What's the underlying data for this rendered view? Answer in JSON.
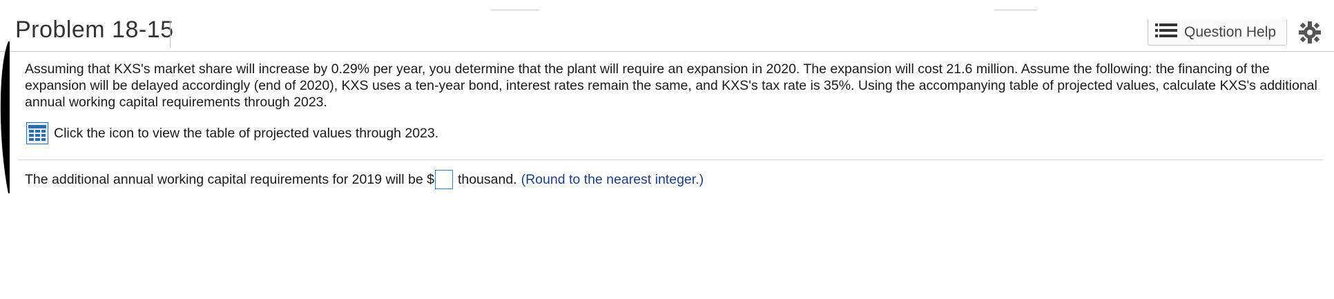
{
  "header": {
    "title": "Problem 18-15",
    "question_help_label": "Question Help",
    "question_help_icon": "list-icon",
    "settings_icon": "gear-icon"
  },
  "problem": {
    "text": "Assuming that KXS's market share will increase by 0.29% per year, you determine that the plant will require an expansion in 2020. The expansion will cost 21.6 million. Assume the following: the financing of the expansion will be delayed accordingly (end of 2020), KXS uses a ten-year bond, interest rates remain the same, and KXS's tax rate is 35%. Using the accompanying table of projected values, calculate KXS's additional annual working capital requirements through 2023.",
    "table_link_text": "Click the icon to view the table of projected values through 2023.",
    "table_icon": "table-icon"
  },
  "answer": {
    "prefix": "The additional annual working capital requirements for 2019 will be $",
    "value": "",
    "suffix": "thousand.",
    "hint": "(Round to the nearest integer.)"
  },
  "colors": {
    "accent_blue": "#2f83c6",
    "hint_blue": "#1c3f8c",
    "icon_blue": "#2b6cb0"
  }
}
